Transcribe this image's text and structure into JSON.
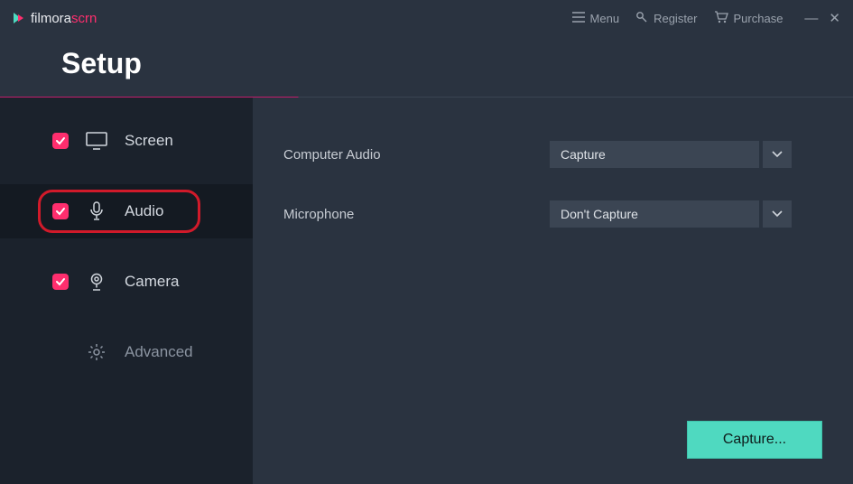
{
  "brand": {
    "name": "filmora",
    "suffix": "scrn"
  },
  "titlebar": {
    "menu": "Menu",
    "register": "Register",
    "purchase": "Purchase"
  },
  "page_title": "Setup",
  "sidebar": {
    "items": [
      {
        "label": "Screen",
        "checked": true
      },
      {
        "label": "Audio",
        "checked": true
      },
      {
        "label": "Camera",
        "checked": true
      },
      {
        "label": "Advanced",
        "checked": false
      }
    ]
  },
  "settings": {
    "computer_audio": {
      "label": "Computer Audio",
      "value": "Capture"
    },
    "microphone": {
      "label": "Microphone",
      "value": "Don't Capture"
    }
  },
  "capture_button": "Capture..."
}
